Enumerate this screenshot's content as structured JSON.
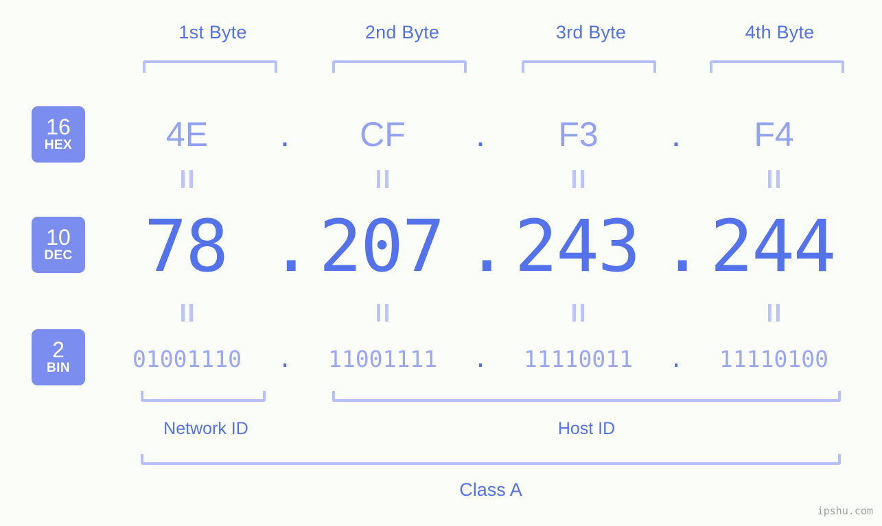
{
  "background_color": "#fbfdf8",
  "accent_color": "#5472ea",
  "accent_light_color": "#b6c0fa",
  "badge_color": "#7b8ef0",
  "byte_headers": [
    {
      "label": "1st Byte"
    },
    {
      "label": "2nd Byte"
    },
    {
      "label": "3rd Byte"
    },
    {
      "label": "4th Byte"
    }
  ],
  "radix_badges": [
    {
      "number": "16",
      "unit": "HEX"
    },
    {
      "number": "10",
      "unit": "DEC"
    },
    {
      "number": "2",
      "unit": "BIN"
    }
  ],
  "separator": ".",
  "rows": {
    "hex": {
      "name": "hex",
      "values": [
        "4E",
        "CF",
        "F3",
        "F4"
      ]
    },
    "dec": {
      "name": "dec",
      "values": [
        "78",
        "207",
        "243",
        "244"
      ]
    },
    "bin": {
      "name": "bin",
      "values": [
        "01001110",
        "11001111",
        "11110011",
        "11110100"
      ]
    }
  },
  "equals_symbol": "=",
  "sections": {
    "network_id": "Network ID",
    "host_id": "Host ID",
    "ip_class": "Class A"
  },
  "watermark": "ipshu.com",
  "chart_data": {
    "type": "table",
    "title": "IP Address 78.207.243.244 byte breakdown",
    "columns": [
      "1st Byte",
      "2nd Byte",
      "3rd Byte",
      "4th Byte"
    ],
    "rows": [
      {
        "radix": "16",
        "unit": "HEX",
        "values": [
          "4E",
          "CF",
          "F3",
          "F4"
        ]
      },
      {
        "radix": "10",
        "unit": "DEC",
        "values": [
          "78",
          "207",
          "243",
          "244"
        ]
      },
      {
        "radix": "2",
        "unit": "BIN",
        "values": [
          "01001110",
          "11001111",
          "11110011",
          "11110100"
        ]
      }
    ],
    "annotations": {
      "network_id_span": [
        "1st Byte"
      ],
      "host_id_span": [
        "2nd Byte",
        "3rd Byte",
        "4th Byte"
      ],
      "class": "Class A"
    }
  }
}
